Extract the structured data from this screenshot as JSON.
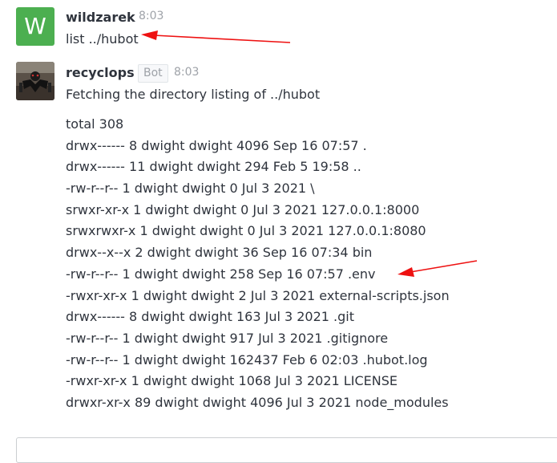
{
  "colors": {
    "avatar_w_bg": "#4caf50",
    "annotation_arrow": "#ee1111",
    "text": "#2f343d",
    "muted": "#9ea2a8"
  },
  "messages": [
    {
      "avatar_letter": "W",
      "username": "wildzarek",
      "time": "8:03",
      "body": "list ../hubot"
    },
    {
      "avatar_icon": "user-photo-avatar",
      "username": "recyclops",
      "badge": "Bot",
      "time": "8:03",
      "body": "Fetching the directory listing of ../hubot",
      "listing": [
        "total 308",
        "drwx------ 8 dwight dwight 4096 Sep 16 07:57 .",
        "drwx------ 11 dwight dwight 294 Feb 5 19:58 ..",
        "-rw-r--r-- 1 dwight dwight 0 Jul 3 2021 \\",
        "srwxr-xr-x 1 dwight dwight 0 Jul 3 2021 127.0.0.1:8000",
        "srwxrwxr-x 1 dwight dwight 0 Jul 3 2021 127.0.0.1:8080",
        "drwx--x--x 2 dwight dwight 36 Sep 16 07:34 bin",
        "-rw-r--r-- 1 dwight dwight 258 Sep 16 07:57 .env",
        "-rwxr-xr-x 1 dwight dwight 2 Jul 3 2021 external-scripts.json",
        "drwx------ 8 dwight dwight 163 Jul 3 2021 .git",
        "-rw-r--r-- 1 dwight dwight 917 Jul 3 2021 .gitignore",
        "-rw-r--r-- 1 dwight dwight 162437 Feb 6 02:03 .hubot.log",
        "-rwxr-xr-x 1 dwight dwight 1068 Jul 3 2021 LICENSE",
        "drwxr-xr-x 89 dwight dwight 4096 Jul 3 2021 node_modules"
      ]
    }
  ]
}
